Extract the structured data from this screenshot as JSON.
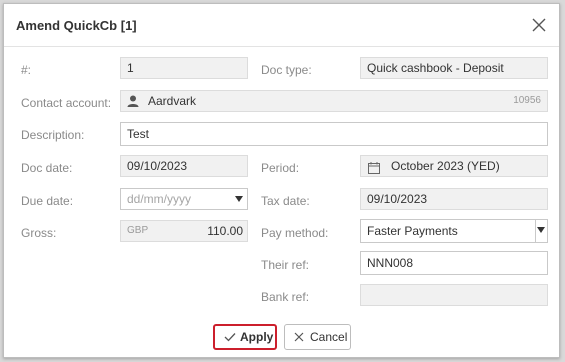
{
  "dialog": {
    "title": "Amend QuickCb [1]"
  },
  "form": {
    "number": {
      "label": "#:",
      "value": "1"
    },
    "doc_type": {
      "label": "Doc type:",
      "value": "Quick cashbook - Deposit"
    },
    "contact_account": {
      "label": "Contact account:",
      "value": "Aardvark",
      "code": "10956",
      "icon": "person-icon"
    },
    "description": {
      "label": "Description:",
      "value": "Test"
    },
    "doc_date": {
      "label": "Doc date:",
      "value": "09/10/2023"
    },
    "period": {
      "label": "Period:",
      "value": "October 2023 (YED)",
      "icon": "calendar-icon"
    },
    "due_date": {
      "label": "Due date:",
      "placeholder": "dd/mm/yyyy"
    },
    "tax_date": {
      "label": "Tax date:",
      "value": "09/10/2023"
    },
    "gross": {
      "label": "Gross:",
      "currency": "GBP",
      "value": "110.00"
    },
    "pay_method": {
      "label": "Pay method:",
      "value": "Faster Payments"
    },
    "their_ref": {
      "label": "Their ref:",
      "value": "NNN008"
    },
    "bank_ref": {
      "label": "Bank ref:",
      "value": ""
    }
  },
  "buttons": {
    "apply": "Apply",
    "cancel": "Cancel"
  },
  "colors": {
    "apply_border": "#cc1f2c",
    "readonly_bg": "#f1f1f1"
  }
}
